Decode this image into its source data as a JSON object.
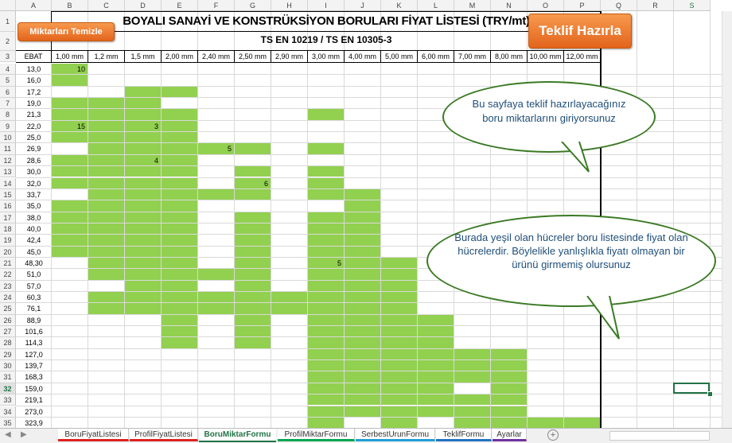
{
  "sheet": {
    "title": "BOYALI SANAYİ VE KONSTRÜKSİYON BORULARI FİYAT LİSTESİ (TRY/mt)",
    "subtitle": "TS EN 10219 / TS EN 10305-3",
    "ebat_header": "EBAT",
    "selected_row": "32"
  },
  "columns": [
    "A",
    "B",
    "C",
    "D",
    "E",
    "F",
    "G",
    "H",
    "I",
    "J",
    "K",
    "L",
    "M",
    "N",
    "O",
    "P",
    "Q",
    "R",
    "S"
  ],
  "sizes": [
    "1,00 mm",
    "1,2 mm",
    "1,5 mm",
    "2,00 mm",
    "2,40 mm",
    "2,50 mm",
    "2,90 mm",
    "3,00 mm",
    "4,00 mm",
    "5,00 mm",
    "6,00 mm",
    "7,00 mm",
    "8,00 mm",
    "10,00 mm",
    "12,00 mm"
  ],
  "rows": [
    {
      "num": "4",
      "ebat": "13,0"
    },
    {
      "num": "5",
      "ebat": "16,0"
    },
    {
      "num": "6",
      "ebat": "17,2"
    },
    {
      "num": "7",
      "ebat": "19,0"
    },
    {
      "num": "8",
      "ebat": "21,3"
    },
    {
      "num": "9",
      "ebat": "22,0"
    },
    {
      "num": "10",
      "ebat": "25,0"
    },
    {
      "num": "11",
      "ebat": "26,9"
    },
    {
      "num": "12",
      "ebat": "28,6"
    },
    {
      "num": "13",
      "ebat": "30,0"
    },
    {
      "num": "14",
      "ebat": "32,0"
    },
    {
      "num": "15",
      "ebat": "33,7"
    },
    {
      "num": "16",
      "ebat": "35,0"
    },
    {
      "num": "17",
      "ebat": "38,0"
    },
    {
      "num": "18",
      "ebat": "40,0"
    },
    {
      "num": "19",
      "ebat": "42,4"
    },
    {
      "num": "20",
      "ebat": "45,0"
    },
    {
      "num": "21",
      "ebat": "48,30"
    },
    {
      "num": "22",
      "ebat": "51,0"
    },
    {
      "num": "23",
      "ebat": "57,0"
    },
    {
      "num": "24",
      "ebat": "60,3"
    },
    {
      "num": "25",
      "ebat": "76,1"
    },
    {
      "num": "26",
      "ebat": "88,9"
    },
    {
      "num": "27",
      "ebat": "101,6"
    },
    {
      "num": "28",
      "ebat": "114,3"
    },
    {
      "num": "29",
      "ebat": "127,0"
    },
    {
      "num": "30",
      "ebat": "139,7"
    },
    {
      "num": "31",
      "ebat": "168,3"
    },
    {
      "num": "32",
      "ebat": "159,0"
    },
    {
      "num": "33",
      "ebat": "219,1"
    },
    {
      "num": "34",
      "ebat": "273,0"
    },
    {
      "num": "35",
      "ebat": "323,9"
    }
  ],
  "green_cells": {
    "B": [
      4,
      5,
      7,
      8,
      9,
      10,
      12,
      13,
      14,
      16,
      17,
      18,
      19,
      20
    ],
    "C": [
      7,
      8,
      9,
      10,
      11,
      12,
      13,
      14,
      15,
      16,
      17,
      18,
      19,
      20,
      21,
      22,
      24,
      25
    ],
    "D": [
      6,
      7,
      8,
      9,
      10,
      11,
      12,
      13,
      14,
      15,
      16,
      17,
      18,
      19,
      20,
      21,
      22,
      23,
      24,
      25
    ],
    "E": [
      6,
      8,
      9,
      10,
      11,
      12,
      13,
      14,
      15,
      16,
      17,
      18,
      19,
      20,
      21,
      22,
      23,
      24,
      25,
      26,
      27,
      28
    ],
    "F": [
      11,
      15,
      22,
      24,
      25
    ],
    "G": [
      11,
      13,
      14,
      15,
      17,
      18,
      19,
      20,
      21,
      22,
      23,
      24,
      25,
      26,
      27,
      28
    ],
    "H": [
      24,
      25
    ],
    "I": [
      8,
      11,
      13,
      14,
      15,
      17,
      18,
      19,
      20,
      21,
      22,
      23,
      24,
      25,
      26,
      27,
      28,
      29,
      30,
      31,
      32,
      33,
      34,
      35
    ],
    "J": [
      15,
      16,
      17,
      18,
      19,
      20,
      21,
      22,
      23,
      24,
      25,
      26,
      27,
      28,
      29,
      30,
      31,
      32,
      33,
      34
    ],
    "K": [
      21,
      22,
      23,
      24,
      25,
      26,
      27,
      28,
      29,
      30,
      31,
      32,
      33,
      34,
      35
    ],
    "L": [
      26,
      27,
      28,
      29,
      30,
      31,
      32,
      33,
      34
    ],
    "M": [
      29,
      30,
      31,
      33,
      34,
      35
    ],
    "N": [
      29,
      30,
      31,
      32,
      33,
      34,
      35
    ],
    "O": [
      35
    ],
    "P": [
      35
    ]
  },
  "values": [
    {
      "col": "B",
      "row": 4,
      "v": "10"
    },
    {
      "col": "B",
      "row": 9,
      "v": "15"
    },
    {
      "col": "D",
      "row": 9,
      "v": "3"
    },
    {
      "col": "D",
      "row": 12,
      "v": "4"
    },
    {
      "col": "F",
      "row": 11,
      "v": "5"
    },
    {
      "col": "G",
      "row": 14,
      "v": "6"
    },
    {
      "col": "I",
      "row": 21,
      "v": "5"
    }
  ],
  "buttons": {
    "clear_label": "Miktarları Temizle",
    "quote_label": "Teklif Hazırla"
  },
  "callouts": {
    "first": "Bu sayfaya teklif hazırlayacağınız boru miktarlarını giriyorsunuz",
    "second": "Burada yeşil olan hücreler boru listesinde fiyat olan hücrelerdir. Böylelikle yanlışlıkla fiyatı olmayan bir ürünü girmemiş olursunuz"
  },
  "tabs": [
    {
      "label": "BoruFiyatListesi",
      "color": "#e02020"
    },
    {
      "label": "ProfilFiyatListesi",
      "color": "#e02020"
    },
    {
      "label": "BoruMiktarFormu",
      "color": "#ffffff",
      "active": true
    },
    {
      "label": "ProfilMiktarFormu",
      "color": "#00a651"
    },
    {
      "label": "SerbestUrunFormu",
      "color": "#1e9fd8"
    },
    {
      "label": "TeklifFormu",
      "color": "#2272c3"
    },
    {
      "label": "Ayarlar",
      "color": "#7030a0"
    }
  ],
  "colors": {
    "green": "#92d050",
    "bubble_border": "#3b7a24",
    "bubble_text": "#1f4e79",
    "button": "#e3641c"
  }
}
